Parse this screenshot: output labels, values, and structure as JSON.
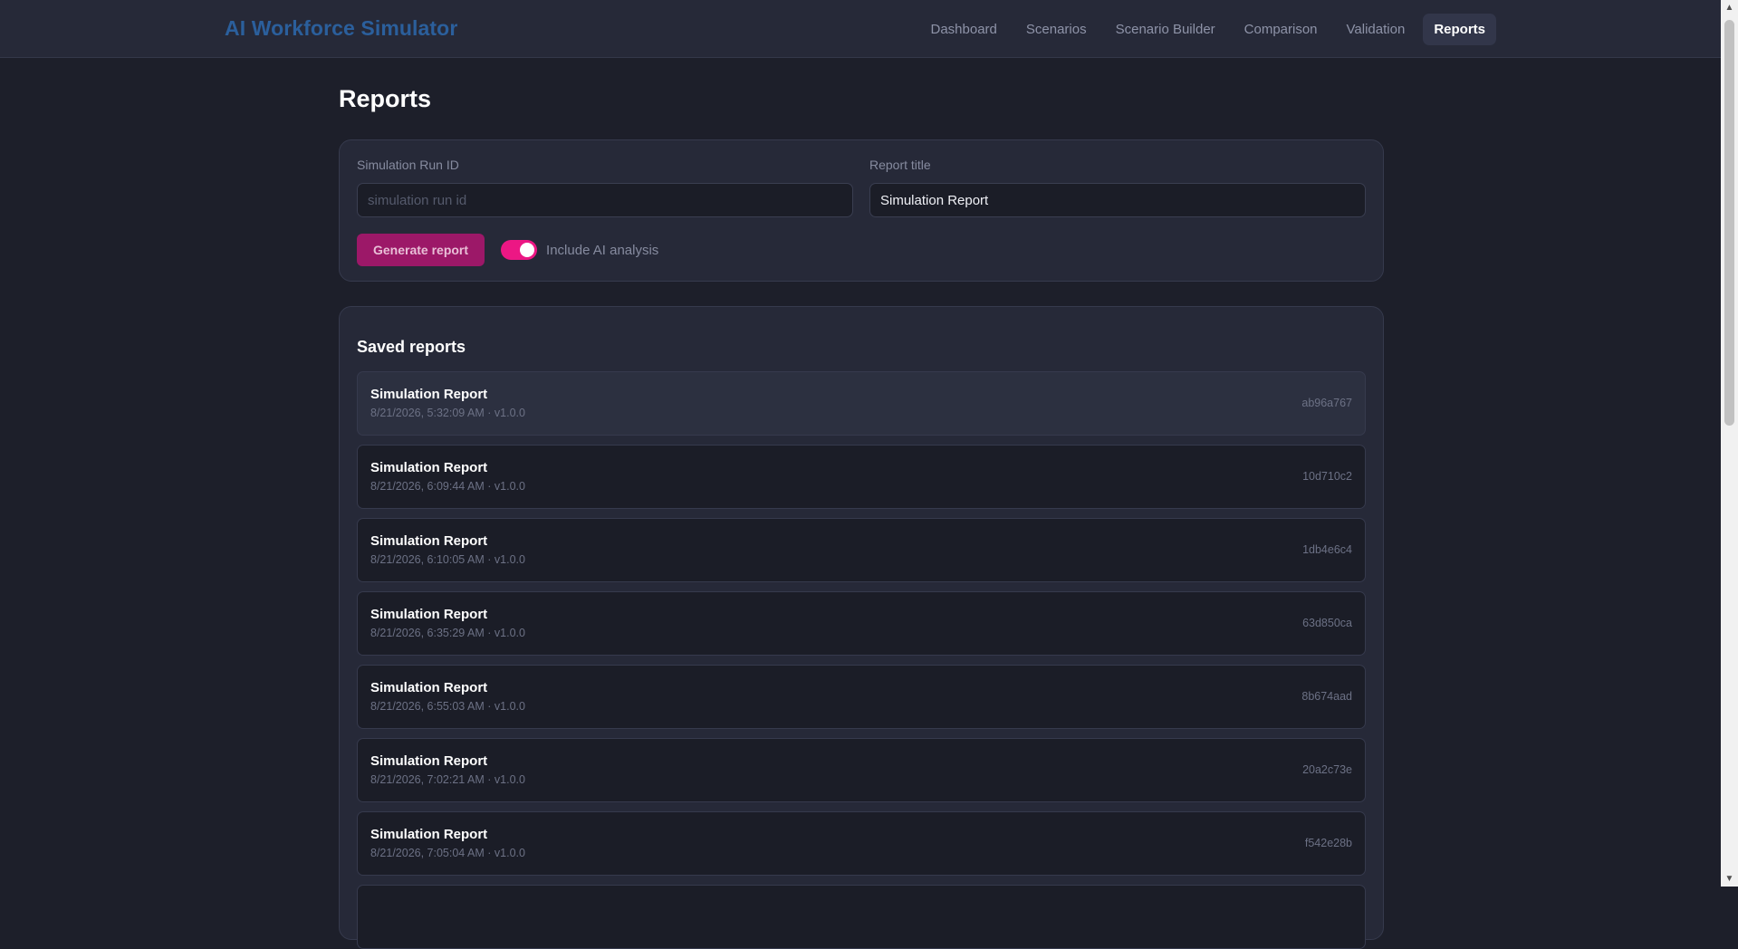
{
  "app": {
    "brand": "AI Workforce Simulator"
  },
  "nav": {
    "items": [
      {
        "label": "Dashboard",
        "active": false
      },
      {
        "label": "Scenarios",
        "active": false
      },
      {
        "label": "Scenario Builder",
        "active": false
      },
      {
        "label": "Comparison",
        "active": false
      },
      {
        "label": "Validation",
        "active": false
      },
      {
        "label": "Reports",
        "active": true
      }
    ]
  },
  "page": {
    "title": "Reports"
  },
  "form": {
    "run_id_label": "Simulation Run ID",
    "run_id_value": "",
    "run_id_placeholder": "simulation run id",
    "title_label": "Report title",
    "title_value": "Simulation Report",
    "generate_label": "Generate report",
    "ai_analysis_label": "Include AI analysis",
    "ai_analysis_enabled": true
  },
  "saved": {
    "title": "Saved reports",
    "reports": [
      {
        "name": "Simulation Report",
        "meta": "8/21/2026, 5:32:09 AM · v1.0.0",
        "id": "ab96a767"
      },
      {
        "name": "Simulation Report",
        "meta": "8/21/2026, 6:09:44 AM · v1.0.0",
        "id": "10d710c2"
      },
      {
        "name": "Simulation Report",
        "meta": "8/21/2026, 6:10:05 AM · v1.0.0",
        "id": "1db4e6c4"
      },
      {
        "name": "Simulation Report",
        "meta": "8/21/2026, 6:35:29 AM · v1.0.0",
        "id": "63d850ca"
      },
      {
        "name": "Simulation Report",
        "meta": "8/21/2026, 6:55:03 AM · v1.0.0",
        "id": "8b674aad"
      },
      {
        "name": "Simulation Report",
        "meta": "8/21/2026, 7:02:21 AM · v1.0.0",
        "id": "20a2c73e"
      },
      {
        "name": "Simulation Report",
        "meta": "8/21/2026, 7:05:04 AM · v1.0.0",
        "id": "f542e28b"
      }
    ]
  },
  "colors": {
    "accent": "#ec1784",
    "button": "#9c1868",
    "brand": "#2b5f9c"
  },
  "icons": {
    "toggle": "toggle-switch-icon",
    "scroll_up": "arrow-up-icon",
    "scroll_down": "arrow-down-icon"
  }
}
